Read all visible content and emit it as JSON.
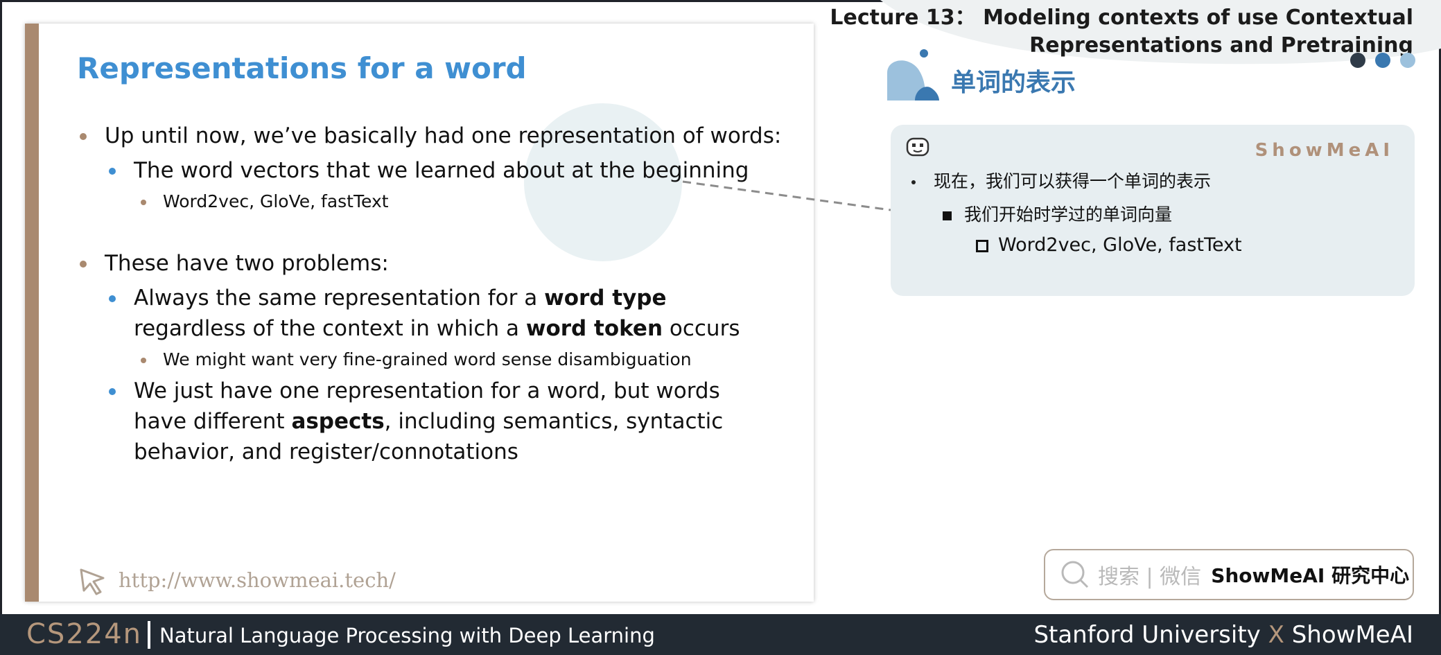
{
  "header": {
    "lecture_title_line1": "Lecture 13： Modeling contexts of use Contextual",
    "lecture_title_line2": "Representations and Pretraining"
  },
  "slide": {
    "title": "Representations for a word",
    "bullets": {
      "b1": "Up until now, we’ve basically had one representation of words:",
      "b1_1": "The word vectors that we learned about at the beginning",
      "b1_1_1": "Word2vec, GloVe, fastText",
      "b2": "These have two problems:",
      "b2_1_pre": "Always the same representation for a ",
      "b2_1_bold1": "word type",
      "b2_1_mid": " regardless of the context in which a ",
      "b2_1_bold2": "word token",
      "b2_1_post": " occurs",
      "b2_1_1": "We might want very fine-grained word sense disambiguation",
      "b2_2_pre": "We just have one representation for a word, but words have different ",
      "b2_2_bold": "aspects",
      "b2_2_post": ", including semantics, syntactic behavior, and register/connotations"
    },
    "url": "http://www.showmeai.tech/"
  },
  "notes": {
    "section_title": "单词的表示",
    "brand": "ShowMeAI",
    "line1": "现在，我们可以获得一个单词的表示",
    "line2": "我们开始时学过的单词向量",
    "line3": "Word2vec, GloVe, fastText"
  },
  "search": {
    "text": "搜索 | 微信",
    "brand": "ShowMeAI 研究中心"
  },
  "footer": {
    "course_code": "CS224n",
    "course_name": "Natural Language Processing with Deep Learning",
    "credit_left": "Stanford University",
    "credit_x": "X",
    "credit_right": "ShowMeAI"
  },
  "colors": {
    "accent_blue": "#3f8fd2",
    "accent_brown": "#a9896f",
    "footer_bg": "#222a33",
    "note_bg": "#e7eef1"
  }
}
